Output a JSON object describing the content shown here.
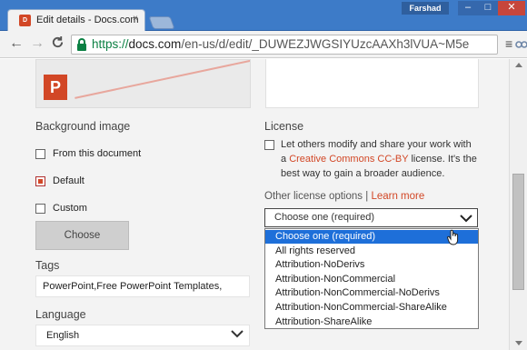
{
  "browser": {
    "tab_title": "Edit details - Docs.com",
    "tab_icon": "docs-com-icon",
    "tab_close": "×",
    "user": "Farshad",
    "window_controls": {
      "minimize": "–",
      "maximize": "□",
      "close": "✕"
    },
    "nav": {
      "back": "←",
      "forward": "→",
      "reload": "C"
    },
    "url": {
      "scheme": "https://",
      "host": "docs.com",
      "path": "/en-us/d/edit/_DUWEZJWGSIYUzcAAXh3lVUA~M5e"
    },
    "star": "☆",
    "menu": "≡"
  },
  "form": {
    "background_image": {
      "label": "Background image",
      "options": [
        {
          "label": "From this document",
          "checked": false
        },
        {
          "label": "Default",
          "checked": true
        },
        {
          "label": "Custom",
          "checked": false
        }
      ],
      "choose_label": "Choose"
    },
    "tags": {
      "label": "Tags",
      "value": "PowerPoint,Free PowerPoint Templates,"
    },
    "language": {
      "label": "Language",
      "value": "English"
    },
    "license": {
      "label": "License",
      "checkbox_checked": false,
      "text_line1": "Let others modify and share your work with",
      "text_line2_prefix": "a ",
      "text_line2_link": "Creative Commons CC-BY",
      "text_line2_suffix": " license. It's the",
      "text_line3": "best way to gain a broader audience."
    },
    "other_license": {
      "label": "Other license options",
      "separator": "|",
      "learn_more": "Learn more",
      "selected": "Choose one (required)",
      "options": [
        "Choose one (required)",
        "All rights reserved",
        "Attribution-NoDerivs",
        "Attribution-NonCommercial",
        "Attribution-NonCommercial-NoDerivs",
        "Attribution-NonCommercial-ShareAlike",
        "Attribution-ShareAlike"
      ]
    }
  },
  "thumbnail_icon": "P",
  "colors": {
    "accent": "#d24726",
    "titlebar": "#3d7bc8",
    "selection": "#1e6fd9"
  }
}
